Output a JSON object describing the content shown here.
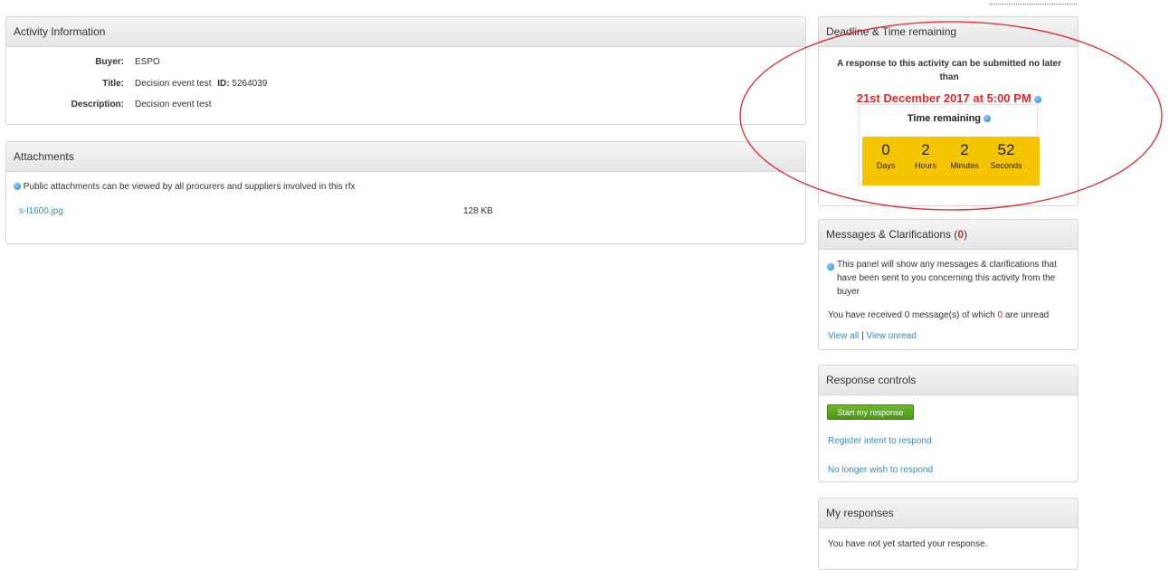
{
  "activity": {
    "title": "Activity Information",
    "buyer_label": "Buyer:",
    "buyer_value": "ESPO",
    "title_label": "Title:",
    "title_value": "Decision event test",
    "id_label": "ID:",
    "id_value": "5264039",
    "description_label": "Description:",
    "description_value": "Decision event test"
  },
  "attachments": {
    "title": "Attachments",
    "note": "Public attachments can be viewed by all procurers and suppliers involved in this rfx",
    "files": [
      {
        "name": "s-l1600.jpg",
        "size": "128 KB"
      }
    ]
  },
  "deadline": {
    "title": "Deadline & Time remaining",
    "notice": "A response to this activity can be submitted no later than",
    "date": "21st December 2017 at 5:00 PM",
    "time_remaining_label": "Time remaining",
    "countdown": [
      {
        "value": "0",
        "label": "Days"
      },
      {
        "value": "2",
        "label": "Hours"
      },
      {
        "value": "2",
        "label": "Minutes"
      },
      {
        "value": "52",
        "label": "Seconds"
      }
    ]
  },
  "messages": {
    "title": "Messages & Clarifications",
    "count_open": "(",
    "count": "0",
    "count_close": ")",
    "info": "This panel will show any messages & clarifications that have been sent to you concerning this activity from the buyer",
    "received_prefix": "You have received 0 message(s) of which",
    "unread_count": "0",
    "received_suffix": "are unread",
    "view_all": "View all",
    "separator": "|",
    "view_unread": "View unread"
  },
  "response_controls": {
    "title": "Response controls",
    "start_button": "Start my response",
    "register_intent": "Register intent to respond",
    "no_longer": "No longer wish to respond"
  },
  "my_responses": {
    "title": "My responses",
    "status": "You have not yet started your response."
  },
  "colors": {
    "accent_red": "#e5262b",
    "link_blue": "#2a8fc9",
    "timer_yellow": "#f5c400",
    "button_green": "#5aa61f"
  }
}
